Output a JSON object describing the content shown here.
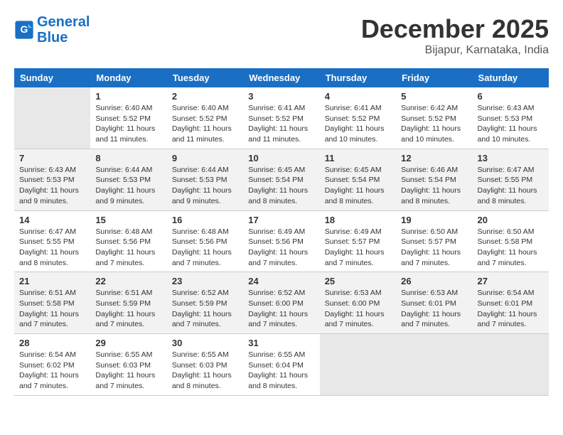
{
  "header": {
    "logo_line1": "General",
    "logo_line2": "Blue",
    "month": "December 2025",
    "location": "Bijapur, Karnataka, India"
  },
  "weekdays": [
    "Sunday",
    "Monday",
    "Tuesday",
    "Wednesday",
    "Thursday",
    "Friday",
    "Saturday"
  ],
  "rows": [
    [
      {
        "day": "",
        "sunrise": "",
        "sunset": "",
        "daylight": ""
      },
      {
        "day": "1",
        "sunrise": "Sunrise: 6:40 AM",
        "sunset": "Sunset: 5:52 PM",
        "daylight": "Daylight: 11 hours and 11 minutes."
      },
      {
        "day": "2",
        "sunrise": "Sunrise: 6:40 AM",
        "sunset": "Sunset: 5:52 PM",
        "daylight": "Daylight: 11 hours and 11 minutes."
      },
      {
        "day": "3",
        "sunrise": "Sunrise: 6:41 AM",
        "sunset": "Sunset: 5:52 PM",
        "daylight": "Daylight: 11 hours and 11 minutes."
      },
      {
        "day": "4",
        "sunrise": "Sunrise: 6:41 AM",
        "sunset": "Sunset: 5:52 PM",
        "daylight": "Daylight: 11 hours and 10 minutes."
      },
      {
        "day": "5",
        "sunrise": "Sunrise: 6:42 AM",
        "sunset": "Sunset: 5:52 PM",
        "daylight": "Daylight: 11 hours and 10 minutes."
      },
      {
        "day": "6",
        "sunrise": "Sunrise: 6:43 AM",
        "sunset": "Sunset: 5:53 PM",
        "daylight": "Daylight: 11 hours and 10 minutes."
      }
    ],
    [
      {
        "day": "7",
        "sunrise": "Sunrise: 6:43 AM",
        "sunset": "Sunset: 5:53 PM",
        "daylight": "Daylight: 11 hours and 9 minutes."
      },
      {
        "day": "8",
        "sunrise": "Sunrise: 6:44 AM",
        "sunset": "Sunset: 5:53 PM",
        "daylight": "Daylight: 11 hours and 9 minutes."
      },
      {
        "day": "9",
        "sunrise": "Sunrise: 6:44 AM",
        "sunset": "Sunset: 5:53 PM",
        "daylight": "Daylight: 11 hours and 9 minutes."
      },
      {
        "day": "10",
        "sunrise": "Sunrise: 6:45 AM",
        "sunset": "Sunset: 5:54 PM",
        "daylight": "Daylight: 11 hours and 8 minutes."
      },
      {
        "day": "11",
        "sunrise": "Sunrise: 6:45 AM",
        "sunset": "Sunset: 5:54 PM",
        "daylight": "Daylight: 11 hours and 8 minutes."
      },
      {
        "day": "12",
        "sunrise": "Sunrise: 6:46 AM",
        "sunset": "Sunset: 5:54 PM",
        "daylight": "Daylight: 11 hours and 8 minutes."
      },
      {
        "day": "13",
        "sunrise": "Sunrise: 6:47 AM",
        "sunset": "Sunset: 5:55 PM",
        "daylight": "Daylight: 11 hours and 8 minutes."
      }
    ],
    [
      {
        "day": "14",
        "sunrise": "Sunrise: 6:47 AM",
        "sunset": "Sunset: 5:55 PM",
        "daylight": "Daylight: 11 hours and 8 minutes."
      },
      {
        "day": "15",
        "sunrise": "Sunrise: 6:48 AM",
        "sunset": "Sunset: 5:56 PM",
        "daylight": "Daylight: 11 hours and 7 minutes."
      },
      {
        "day": "16",
        "sunrise": "Sunrise: 6:48 AM",
        "sunset": "Sunset: 5:56 PM",
        "daylight": "Daylight: 11 hours and 7 minutes."
      },
      {
        "day": "17",
        "sunrise": "Sunrise: 6:49 AM",
        "sunset": "Sunset: 5:56 PM",
        "daylight": "Daylight: 11 hours and 7 minutes."
      },
      {
        "day": "18",
        "sunrise": "Sunrise: 6:49 AM",
        "sunset": "Sunset: 5:57 PM",
        "daylight": "Daylight: 11 hours and 7 minutes."
      },
      {
        "day": "19",
        "sunrise": "Sunrise: 6:50 AM",
        "sunset": "Sunset: 5:57 PM",
        "daylight": "Daylight: 11 hours and 7 minutes."
      },
      {
        "day": "20",
        "sunrise": "Sunrise: 6:50 AM",
        "sunset": "Sunset: 5:58 PM",
        "daylight": "Daylight: 11 hours and 7 minutes."
      }
    ],
    [
      {
        "day": "21",
        "sunrise": "Sunrise: 6:51 AM",
        "sunset": "Sunset: 5:58 PM",
        "daylight": "Daylight: 11 hours and 7 minutes."
      },
      {
        "day": "22",
        "sunrise": "Sunrise: 6:51 AM",
        "sunset": "Sunset: 5:59 PM",
        "daylight": "Daylight: 11 hours and 7 minutes."
      },
      {
        "day": "23",
        "sunrise": "Sunrise: 6:52 AM",
        "sunset": "Sunset: 5:59 PM",
        "daylight": "Daylight: 11 hours and 7 minutes."
      },
      {
        "day": "24",
        "sunrise": "Sunrise: 6:52 AM",
        "sunset": "Sunset: 6:00 PM",
        "daylight": "Daylight: 11 hours and 7 minutes."
      },
      {
        "day": "25",
        "sunrise": "Sunrise: 6:53 AM",
        "sunset": "Sunset: 6:00 PM",
        "daylight": "Daylight: 11 hours and 7 minutes."
      },
      {
        "day": "26",
        "sunrise": "Sunrise: 6:53 AM",
        "sunset": "Sunset: 6:01 PM",
        "daylight": "Daylight: 11 hours and 7 minutes."
      },
      {
        "day": "27",
        "sunrise": "Sunrise: 6:54 AM",
        "sunset": "Sunset: 6:01 PM",
        "daylight": "Daylight: 11 hours and 7 minutes."
      }
    ],
    [
      {
        "day": "28",
        "sunrise": "Sunrise: 6:54 AM",
        "sunset": "Sunset: 6:02 PM",
        "daylight": "Daylight: 11 hours and 7 minutes."
      },
      {
        "day": "29",
        "sunrise": "Sunrise: 6:55 AM",
        "sunset": "Sunset: 6:03 PM",
        "daylight": "Daylight: 11 hours and 7 minutes."
      },
      {
        "day": "30",
        "sunrise": "Sunrise: 6:55 AM",
        "sunset": "Sunset: 6:03 PM",
        "daylight": "Daylight: 11 hours and 8 minutes."
      },
      {
        "day": "31",
        "sunrise": "Sunrise: 6:55 AM",
        "sunset": "Sunset: 6:04 PM",
        "daylight": "Daylight: 11 hours and 8 minutes."
      },
      {
        "day": "",
        "sunrise": "",
        "sunset": "",
        "daylight": ""
      },
      {
        "day": "",
        "sunrise": "",
        "sunset": "",
        "daylight": ""
      },
      {
        "day": "",
        "sunrise": "",
        "sunset": "",
        "daylight": ""
      }
    ]
  ]
}
